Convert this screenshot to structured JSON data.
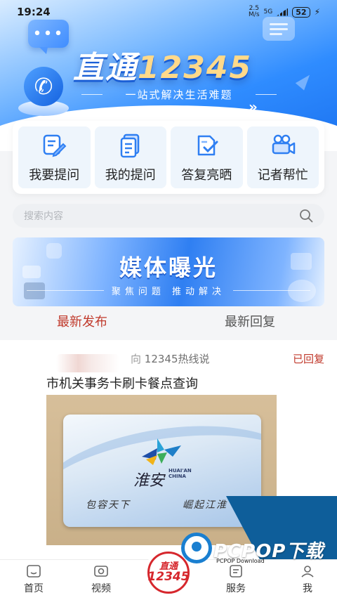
{
  "status_bar": {
    "time": "19:24",
    "net_speed": "2.5",
    "net_unit": "M/s",
    "network": "5G",
    "battery": "52"
  },
  "hero": {
    "brand_text": "直通",
    "brand_number": "12345",
    "slogan": "一站式解决生活难题"
  },
  "actions": [
    {
      "label": "我要提问",
      "icon": "edit-question-icon"
    },
    {
      "label": "我的提问",
      "icon": "document-list-icon"
    },
    {
      "label": "答复亮晒",
      "icon": "check-document-icon"
    },
    {
      "label": "记者帮忙",
      "icon": "video-camera-icon"
    }
  ],
  "search": {
    "placeholder": "搜索内容"
  },
  "banner": {
    "title": "媒体曝光",
    "subtitle": "聚焦问题  推动解决"
  },
  "tabs": [
    {
      "label": "最新发布",
      "active": true
    },
    {
      "label": "最新回复",
      "active": false
    }
  ],
  "post": {
    "to_prefix": "向",
    "to_target": "12345热线说",
    "status": "已回复",
    "title": "市机关事务卡刷卡餐点查询",
    "card": {
      "city": "淮安",
      "pinyin_1": "HUAI'AN",
      "pinyin_2": "CHINA",
      "motto_1": "包容天下",
      "motto_2": "崛起江淮"
    }
  },
  "nav": [
    {
      "label": "首页",
      "icon": "home-icon"
    },
    {
      "label": "视频",
      "icon": "video-icon"
    },
    {
      "label": "服务",
      "icon": "service-icon"
    },
    {
      "label": "我",
      "icon": "profile-icon"
    }
  ],
  "nav_center": {
    "top": "直通",
    "bottom": "12345"
  },
  "watermark": {
    "brand": "PCPOP下载",
    "sub": "PCPOP Download"
  },
  "colors": {
    "primary_blue": "#2f7ff2",
    "accent_red": "#c0392b",
    "logo_red": "#d6272d"
  }
}
